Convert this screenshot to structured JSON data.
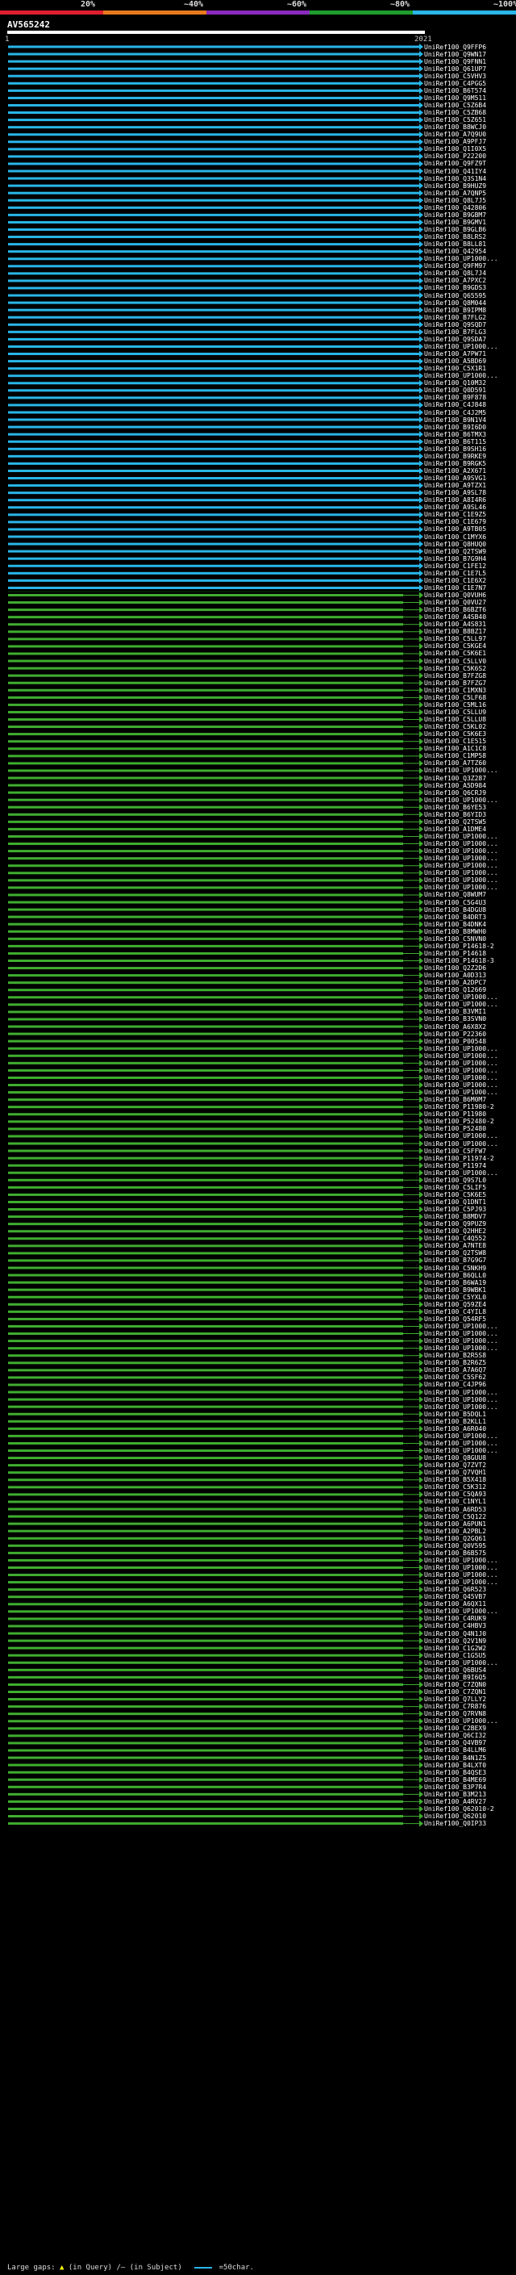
{
  "query": {
    "name": "AV565242",
    "start": "1",
    "end": "2021"
  },
  "identity_scale": {
    "labels": [
      "20%",
      "~40%",
      "~60%",
      "~80%",
      "~100%"
    ],
    "colors": [
      "#e01e2f",
      "#e87a1e",
      "#8a2bbf",
      "#1f9e2d",
      "#29b6e8"
    ]
  },
  "colors": {
    "blue": "#29b6e8",
    "green": "#3fae2f",
    "dark": "#004400",
    "insertion": "#ffff00"
  },
  "hits": [
    "UniRef100_Q9FFP6",
    "UniRef100_Q9WN17",
    "UniRef100_Q9FNN1",
    "UniRef100_Q61UP7",
    "UniRef100_C5VHV3",
    "UniRef100_C4PGG5",
    "UniRef100_B6T574",
    "UniRef100_Q9M511",
    "UniRef100_C5Z6B4",
    "UniRef100_C5ZB68",
    "UniRef100_C5Z651",
    "UniRef100_B8WCJ0",
    "UniRef100_A7Q9U0",
    "UniRef100_A9PFJ7",
    "UniRef100_Q1I0X5",
    "UniRef100_P22200",
    "UniRef100_Q9FZ9T",
    "UniRef100_Q41IY4",
    "UniRef100_Q3S1N4",
    "UniRef100_B9HUZ9",
    "UniRef100_A7QNP5",
    "UniRef100_Q8L7J5",
    "UniRef100_Q42806",
    "UniRef100_B9GBM7",
    "UniRef100_B9GMV1",
    "UniRef100_B9GLB6",
    "UniRef100_B8LRS2",
    "UniRef100_B8LL81",
    "UniRef100_Q42954",
    "UniRef100_UP1000...",
    "UniRef100_Q9FM97",
    "UniRef100_Q8L7J4",
    "UniRef100_A7PXC2",
    "UniRef100_B9GDS3",
    "UniRef100_Q65595",
    "UniRef100_Q8M044",
    "UniRef100_B9IPM8",
    "UniRef100_B7FLG2",
    "UniRef100_Q9SQD7",
    "UniRef100_B7FLG3",
    "UniRef100_Q9SDA7",
    "UniRef100_UP1000...",
    "UniRef100_A7PW71",
    "UniRef100_A5BD69",
    "UniRef100_C5X1R1",
    "UniRef100_UP1000...",
    "UniRef100_Q10M32",
    "UniRef100_Q0D591",
    "UniRef100_B9F878",
    "UniRef100_C4J848",
    "UniRef100_C4J2M5",
    "UniRef100_B9N1V4",
    "UniRef100_B9I6D0",
    "UniRef100_B6TMX3",
    "UniRef100_B6T115",
    "UniRef100_B9SH16",
    "UniRef100_B9RKE9",
    "UniRef100_B9RGK5",
    "UniRef100_A2X671",
    "UniRef100_A9SVG1",
    "UniRef100_A9TZX1",
    "UniRef100_A9SL78",
    "UniRef100_A8I4R6",
    "UniRef100_A9SL46",
    "UniRef100_C1E9Z5",
    "UniRef100_C1E679",
    "UniRef100_A9TB05",
    "UniRef100_C1MYX6",
    "UniRef100_Q8HUQ0",
    "UniRef100_Q2TSW9",
    "UniRef100_B7G9H4",
    "UniRef100_C1FE12",
    "UniRef100_C1E7L5",
    "UniRef100_C1E6X2",
    "UniRef100_C1E7N7",
    "UniRef100_Q0VUH6",
    "UniRef100_Q0VU27",
    "UniRef100_B6BZT6",
    "UniRef100_A4SB40",
    "UniRef100_A4S831",
    "UniRef100_B8BZ17",
    "UniRef100_C5LL97",
    "UniRef100_C5KGE4",
    "UniRef100_C5K6E1",
    "UniRef100_C5LLV0",
    "UniRef100_C5K6S2",
    "UniRef100_B7FZG8",
    "UniRef100_B7FZG7",
    "UniRef100_C1MXN3",
    "UniRef100_C5LF68",
    "UniRef100_C5ML16",
    "UniRef100_C5LLU9",
    "UniRef100_C5LLU8",
    "UniRef100_C5KL02",
    "UniRef100_C5K6E3",
    "UniRef100_C1E515",
    "UniRef100_A1C1C8",
    "UniRef100_C1MP58",
    "UniRef100_A7TZ60",
    "UniRef100_UP1000...",
    "UniRef100_Q3Z287",
    "UniRef100_A5D984",
    "UniRef100_Q6CRJ9",
    "UniRef100_UP1000...",
    "UniRef100_B6YE53",
    "UniRef100_B6YID3",
    "UniRef100_Q2TSW5",
    "UniRef100_A1DME4",
    "UniRef100_UP1000...",
    "UniRef100_UP1000...",
    "UniRef100_UP1000...",
    "UniRef100_UP1000...",
    "UniRef100_UP1000...",
    "UniRef100_UP1000...",
    "UniRef100_UP1000...",
    "UniRef100_UP1000...",
    "UniRef100_Q8WUM7",
    "UniRef100_C5G4U3",
    "UniRef100_B4DGU8",
    "UniRef100_B4DRT3",
    "UniRef100_B4DNK4",
    "UniRef100_B8MWH0",
    "UniRef100_C5NVN0",
    "UniRef100_P14618-2",
    "UniRef100_P14618",
    "UniRef100_P14618-3",
    "UniRef100_Q2Z2D6",
    "UniRef100_A0D313",
    "UniRef100_A2DPC7",
    "UniRef100_Q12669",
    "UniRef100_UP1000...",
    "UniRef100_UP1000...",
    "UniRef100_B3VMI1",
    "UniRef100_B3SVN0",
    "UniRef100_A6X8X2",
    "UniRef100_P22360",
    "UniRef100_P00548",
    "UniRef100_UP1000...",
    "UniRef100_UP1000...",
    "UniRef100_UP1000...",
    "UniRef100_UP1000...",
    "UniRef100_UP1000...",
    "UniRef100_UP1000...",
    "UniRef100_UP1000...",
    "UniRef100_B6M0M7",
    "UniRef100_P11980-2",
    "UniRef100_P11980",
    "UniRef100_P52480-2",
    "UniRef100_P52480",
    "UniRef100_UP1000...",
    "UniRef100_UP1000...",
    "UniRef100_C5FFW7",
    "UniRef100_P11974-2",
    "UniRef100_P11974",
    "UniRef100_UP1000...",
    "UniRef100_Q9S7L0",
    "UniRef100_C5LIF5",
    "UniRef100_C5K6E5",
    "UniRef100_Q1DNT1",
    "UniRef100_C5PJ93",
    "UniRef100_B8MDV7",
    "UniRef100_Q9PUZ9",
    "UniRef100_Q2HHE2",
    "UniRef100_C4Q552",
    "UniRef100_A7NTE8",
    "UniRef100_Q2TSW8",
    "UniRef100_B7G9G7",
    "UniRef100_C5NKH9",
    "UniRef100_B6QLL0",
    "UniRef100_B6WA19",
    "UniRef100_B9WBK1",
    "UniRef100_C5YXL0",
    "UniRef100_Q59ZE4",
    "UniRef100_C4YIL8",
    "UniRef100_Q54RF5",
    "UniRef100_UP1000...",
    "UniRef100_UP1000...",
    "UniRef100_UP1000...",
    "UniRef100_UP1000...",
    "UniRef100_B2R5S8",
    "UniRef100_B2R6Z5",
    "UniRef100_A7A6Q7",
    "UniRef100_C5SF62",
    "UniRef100_C4JP96",
    "UniRef100_UP1000...",
    "UniRef100_UP1000...",
    "UniRef100_UP1000...",
    "UniRef100_B5DQL1",
    "UniRef100_B2KLL1",
    "UniRef100_A6R040",
    "UniRef100_UP1000...",
    "UniRef100_UP1000...",
    "UniRef100_UP1000...",
    "UniRef100_Q8GUU8",
    "UniRef100_Q7ZVT2",
    "UniRef100_Q7VQH1",
    "UniRef100_B5X418",
    "UniRef100_C5K312",
    "UniRef100_C5QA93",
    "UniRef100_C1NYL1",
    "UniRef100_A6RD53",
    "UniRef100_C5Q122",
    "UniRef100_A6PUN1",
    "UniRef100_A2PBL2",
    "UniRef100_Q2GQ61",
    "UniRef100_Q0V595",
    "UniRef100_B6B575",
    "UniRef100_UP1000...",
    "UniRef100_UP1000...",
    "UniRef100_UP1000...",
    "UniRef100_UP1000...",
    "UniRef100_Q6R523",
    "UniRef100_Q45VB7",
    "UniRef100_A6QX11",
    "UniRef100_UP1000...",
    "UniRef100_C4RUK9",
    "UniRef100_C4HBV3",
    "UniRef100_Q4N1J0",
    "UniRef100_Q2V1N9",
    "UniRef100_C1G2W2",
    "UniRef100_C1G5U5",
    "UniRef100_UP1000...",
    "UniRef100_Q6BUS4",
    "UniRef100_B9I6Q5",
    "UniRef100_C7ZQN0",
    "UniRef100_C7ZQN1",
    "UniRef100_Q7LLY2",
    "UniRef100_C7R876",
    "UniRef100_Q7RVN8",
    "UniRef100_UP1000...",
    "UniRef100_C2BEX9",
    "UniRef100_Q6CI32",
    "UniRef100_Q4VB97",
    "UniRef100_B4LLM6",
    "UniRef100_B4N1Z5",
    "UniRef100_B4LXT0",
    "UniRef100_B4QSE3",
    "UniRef100_B4ME69",
    "UniRef100_B3P7R4",
    "UniRef100_B3M213",
    "UniRef100_A4RV27",
    "UniRef100_Q62010-2",
    "UniRef100_Q62010",
    "UniRef100_Q0IP33"
  ],
  "footer": {
    "large_gaps_label": "Large gaps:",
    "in_query_label": "(in Query)",
    "in_subject_label": "(in Subject)",
    "segment_label": "=50char."
  }
}
